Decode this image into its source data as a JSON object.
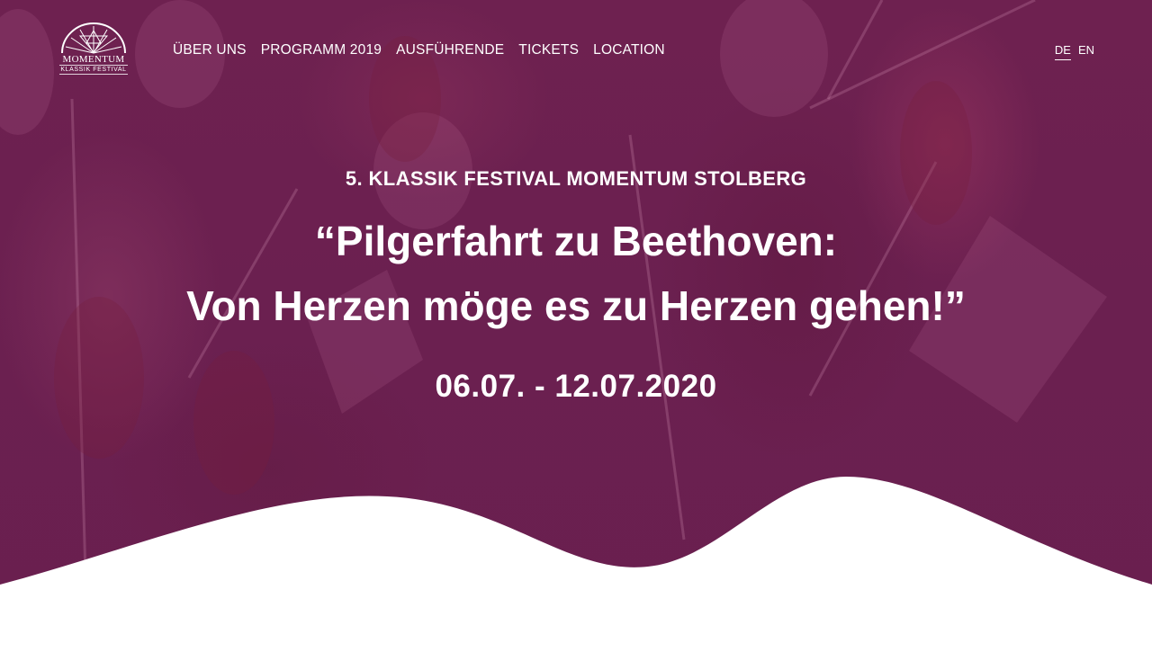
{
  "logo": {
    "main": "MOMENTUM",
    "sub": "KLASSIK FESTIVAL"
  },
  "nav": {
    "items": [
      {
        "label": "ÜBER UNS"
      },
      {
        "label": "PROGRAMM 2019"
      },
      {
        "label": "AUSFÜHRENDE"
      },
      {
        "label": "TICKETS"
      },
      {
        "label": "LOCATION"
      }
    ]
  },
  "lang": {
    "de": "DE",
    "en": "EN",
    "active": "DE"
  },
  "hero": {
    "subtitle": "5. KLASSIK FESTIVAL MOMENTUM STOLBERG",
    "title_line1": "“Pilgerfahrt zu Beethoven:",
    "title_line2": "Von Herzen möge es zu Herzen gehen!”",
    "dates": "06.07. - 12.07.2020"
  },
  "colors": {
    "overlay": "#6b2050",
    "highlight": "#c03b7a",
    "text": "#ffffff"
  }
}
